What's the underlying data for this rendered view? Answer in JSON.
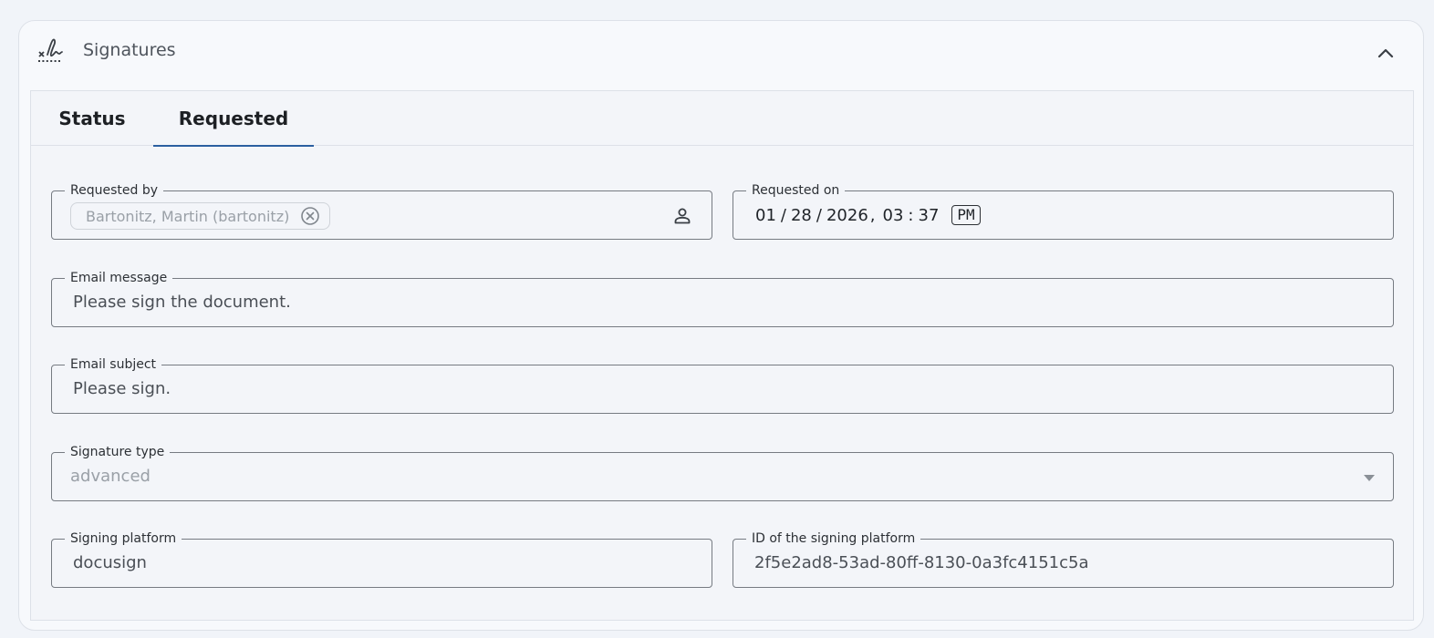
{
  "card": {
    "title": "Signatures",
    "icon": "signature-icon",
    "collapse_icon": "chevron-up-icon"
  },
  "tabs": [
    {
      "label": "Status",
      "active": false
    },
    {
      "label": "Requested",
      "active": true
    }
  ],
  "form": {
    "requested_by": {
      "label": "Requested by",
      "chip": "Bartonitz, Martin (bartonitz)",
      "icon": "person-icon"
    },
    "requested_on": {
      "label": "Requested on",
      "month": "01",
      "day": "28",
      "year": "2026",
      "hour": "03",
      "minute": "37",
      "ampm": "PM"
    },
    "email_message": {
      "label": "Email message",
      "value": "Please sign the document."
    },
    "email_subject": {
      "label": "Email subject",
      "value": "Please sign."
    },
    "signature_type": {
      "label": "Signature type",
      "value": "advanced"
    },
    "signing_platform": {
      "label": "Signing platform",
      "value": "docusign"
    },
    "signing_platform_id": {
      "label": "ID of the signing platform",
      "value": "2f5e2ad8-53ad-80ff-8130-0a3fc4151c5a"
    }
  },
  "colors": {
    "accent": "#2b5fa0",
    "border": "#767b82",
    "muted_text": "#9aa0a7"
  }
}
